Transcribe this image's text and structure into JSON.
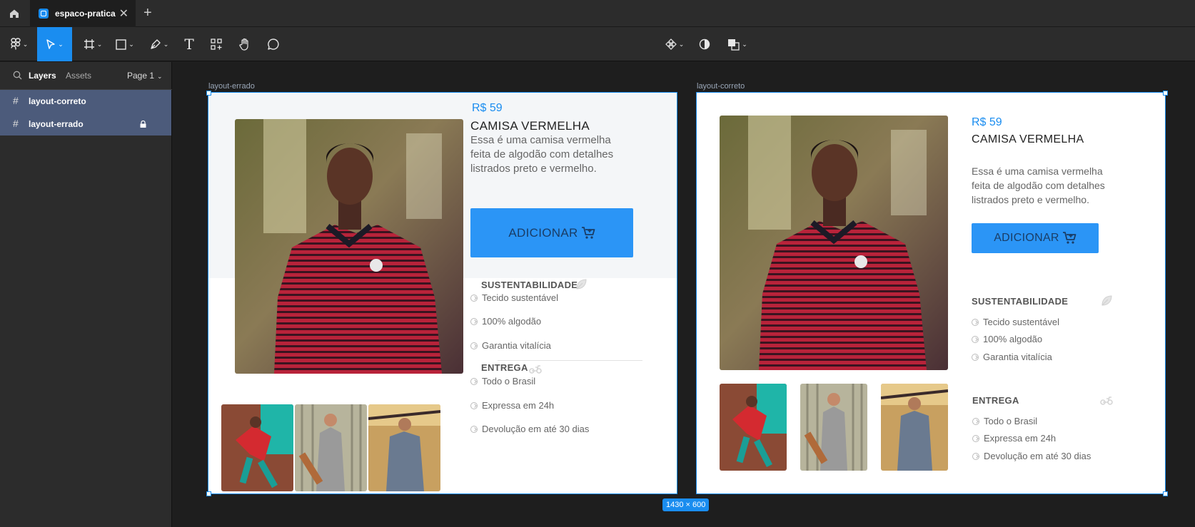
{
  "tabbar": {
    "home_icon": "home-icon",
    "tab_title": "espaco-pratica",
    "close_glyph": "✕",
    "new_tab_glyph": "+"
  },
  "toolbar": {
    "tools": [
      "main-menu",
      "move",
      "frame",
      "rectangle",
      "pen",
      "text",
      "resources",
      "hand",
      "comment"
    ],
    "active_tool": "move",
    "right_tools": [
      "component",
      "contrast",
      "boolean"
    ],
    "text_glyph": "T"
  },
  "left_panel": {
    "tabs": {
      "layers": "Layers",
      "assets": "Assets"
    },
    "page": "Page 1",
    "layers": [
      {
        "name": "layout-correto",
        "locked": false
      },
      {
        "name": "layout-errado",
        "locked": true
      }
    ]
  },
  "canvas": {
    "size_badge": "1430 × 600",
    "frames": [
      {
        "label": "layout-errado",
        "price": "R$ 59",
        "title": "CAMISA VERMELHA",
        "description": "Essa é uma camisa vermelha feita de algodão com detalhes listrados preto e vermelho.",
        "button": "ADICIONAR",
        "sections": [
          {
            "heading": "SUSTENTABILIDADE",
            "icon": "leaf-icon",
            "items": [
              "Tecido sustentável",
              "100% algodão",
              "Garantia vitalícia"
            ]
          },
          {
            "heading": "ENTREGA",
            "icon": "scooter-icon",
            "items": [
              "Todo o Brasil",
              "Expressa em 24h",
              "Devolução em até 30 dias"
            ]
          }
        ]
      },
      {
        "label": "layout-correto",
        "price": "R$ 59",
        "title": "CAMISA VERMELHA",
        "description": "Essa é uma camisa vermelha feita de algodão com detalhes listrados preto e vermelho.",
        "button": "ADICIONAR",
        "sections": [
          {
            "heading": "SUSTENTABILIDADE",
            "icon": "leaf-icon",
            "items": [
              "Tecido sustentável",
              "100% algodão",
              "Garantia vitalícia"
            ]
          },
          {
            "heading": "ENTREGA",
            "icon": "scooter-icon",
            "items": [
              "Todo o Brasil",
              "Expressa em 24h",
              "Devolução em até 30 dias"
            ]
          }
        ]
      }
    ]
  },
  "colors": {
    "accent": "#1a8df0",
    "button": "#2b95f6",
    "price": "#1a8df0"
  }
}
